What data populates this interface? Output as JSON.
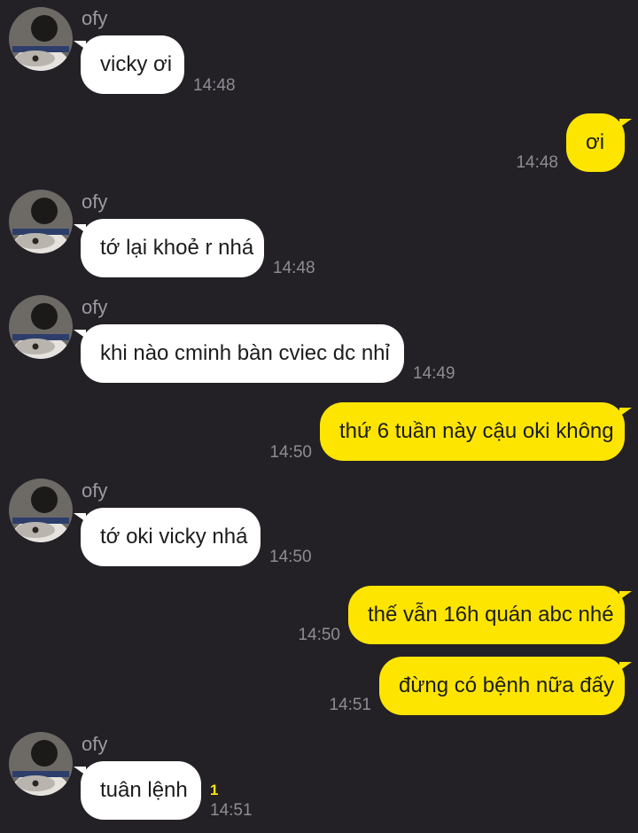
{
  "messages": [
    {
      "direction": "in",
      "sender": "ofy",
      "text": "vicky ơi",
      "time": "14:48"
    },
    {
      "direction": "out",
      "text": "ơi",
      "time": "14:48"
    },
    {
      "direction": "in",
      "sender": "ofy",
      "text": "tớ lại khoẻ r nhá",
      "time": "14:48"
    },
    {
      "direction": "in",
      "sender": "ofy",
      "text": "khi nào cminh bàn cviec dc nhỉ",
      "time": "14:49"
    },
    {
      "direction": "out",
      "text": "thứ 6 tuần này cậu oki không",
      "time": "14:50"
    },
    {
      "direction": "in",
      "sender": "ofy",
      "text": "tớ oki vicky nhá",
      "time": "14:50"
    },
    {
      "direction": "out",
      "text": "thế vẫn 16h quán abc nhé",
      "time": "14:50"
    },
    {
      "direction": "out",
      "text": "đừng có bệnh nữa đấy",
      "time": "14:51"
    },
    {
      "direction": "in",
      "sender": "ofy",
      "text": "tuân lệnh",
      "time": "14:51",
      "unread_count": "1"
    }
  ],
  "colors": {
    "background": "#232126",
    "incoming_bubble": "#ffffff",
    "outgoing_bubble": "#fee500",
    "timestamp": "#8e8c93",
    "unread": "#fee500"
  },
  "icons": {
    "avatar": "profile-photo-guitar"
  }
}
